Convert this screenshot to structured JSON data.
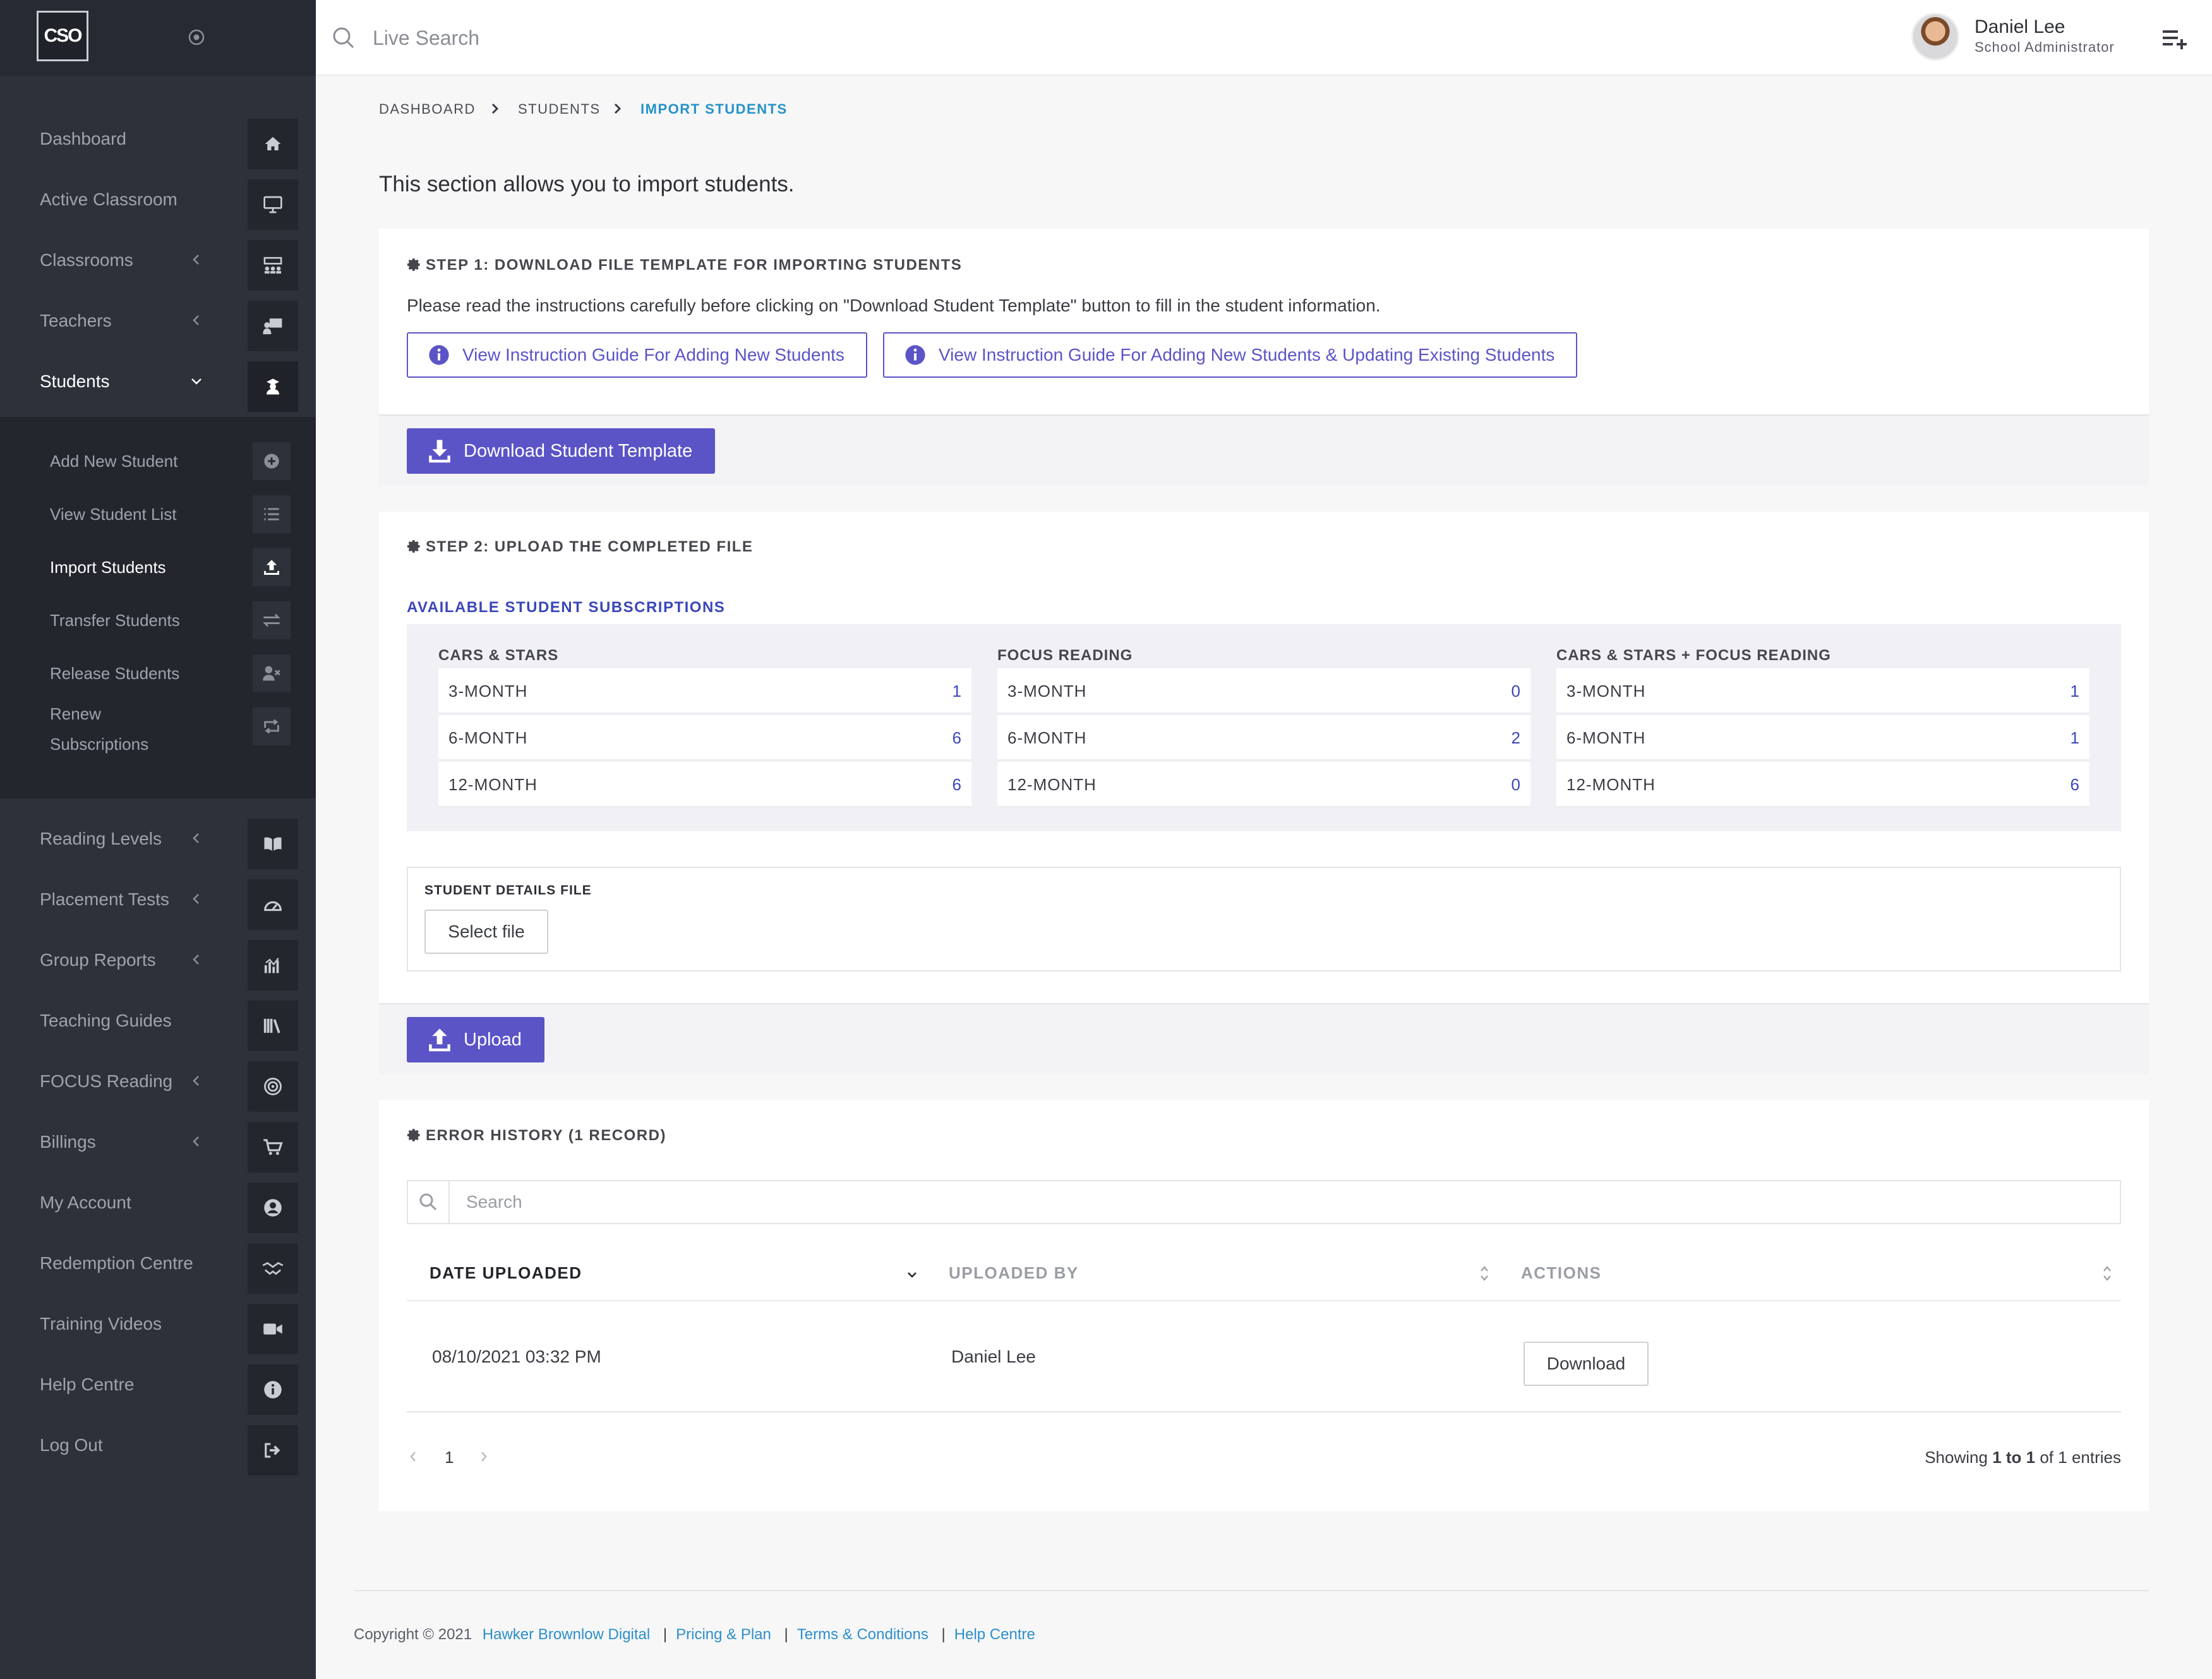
{
  "app": {
    "logo_text": "CSO",
    "search_placeholder": "Live Search"
  },
  "user": {
    "name": "Daniel Lee",
    "role": "School Administrator"
  },
  "sidebar": {
    "items": [
      {
        "label": "Dashboard",
        "icon": "home-icon"
      },
      {
        "label": "Active Classroom",
        "icon": "monitor-icon"
      },
      {
        "label": "Classrooms",
        "icon": "classroom-icon"
      },
      {
        "label": "Teachers",
        "icon": "teacher-icon"
      },
      {
        "label": "Students",
        "icon": "student-icon"
      },
      {
        "label": "Reading Levels",
        "icon": "book-icon"
      },
      {
        "label": "Placement Tests",
        "icon": "gauge-icon"
      },
      {
        "label": "Group Reports",
        "icon": "chart-icon"
      },
      {
        "label": "Teaching Guides",
        "icon": "library-icon"
      },
      {
        "label": "FOCUS Reading",
        "icon": "target-icon"
      },
      {
        "label": "Billings",
        "icon": "cart-icon"
      },
      {
        "label": "My Account",
        "icon": "user-circle-icon"
      },
      {
        "label": "Redemption Centre",
        "icon": "handshake-icon"
      },
      {
        "label": "Training Videos",
        "icon": "video-icon"
      },
      {
        "label": "Help Centre",
        "icon": "info-icon"
      },
      {
        "label": "Log Out",
        "icon": "logout-icon"
      }
    ],
    "students_sub": [
      {
        "label": "Add New Student",
        "icon": "plus-circle-icon"
      },
      {
        "label": "View Student List",
        "icon": "list-icon"
      },
      {
        "label": "Import Students",
        "icon": "upload-icon"
      },
      {
        "label": "Transfer Students",
        "icon": "transfer-icon"
      },
      {
        "label": "Release Students",
        "icon": "user-remove-icon"
      },
      {
        "label": "Renew Subscriptions",
        "icon": "renew-icon"
      }
    ]
  },
  "breadcrumb": [
    "DASHBOARD",
    "STUDENTS",
    "IMPORT STUDENTS"
  ],
  "intro": "This section allows you to import students.",
  "step1": {
    "title": "STEP 1: DOWNLOAD FILE TEMPLATE FOR IMPORTING STUDENTS",
    "instructions": "Please read the instructions carefully before clicking on \"Download Student Template\" button to fill in the student information.",
    "guide_new": "View Instruction Guide For Adding New Students",
    "guide_update": "View Instruction Guide For Adding New Students & Updating Existing Students",
    "download_button": "Download Student Template"
  },
  "step2": {
    "title": "STEP 2: UPLOAD THE COMPLETED FILE",
    "subs_title": "AVAILABLE STUDENT SUBSCRIPTIONS",
    "columns": [
      {
        "title": "CARS & STARS",
        "rows": [
          {
            "k": "3-MONTH",
            "v": "1"
          },
          {
            "k": "6-MONTH",
            "v": "6"
          },
          {
            "k": "12-MONTH",
            "v": "6"
          }
        ]
      },
      {
        "title": "FOCUS READING",
        "rows": [
          {
            "k": "3-MONTH",
            "v": "0"
          },
          {
            "k": "6-MONTH",
            "v": "2"
          },
          {
            "k": "12-MONTH",
            "v": "0"
          }
        ]
      },
      {
        "title": "CARS & STARS + FOCUS READING",
        "rows": [
          {
            "k": "3-MONTH",
            "v": "1"
          },
          {
            "k": "6-MONTH",
            "v": "1"
          },
          {
            "k": "12-MONTH",
            "v": "6"
          }
        ]
      }
    ],
    "file_label": "STUDENT DETAILS FILE",
    "select_file": "Select file",
    "upload_button": "Upload"
  },
  "errors": {
    "title": "ERROR HISTORY (1 RECORD)",
    "search_placeholder": "Search",
    "headers": [
      "DATE UPLOADED",
      "UPLOADED BY",
      "ACTIONS"
    ],
    "rows": [
      {
        "date": "08/10/2021 03:32 PM",
        "by": "Daniel Lee",
        "action": "Download"
      }
    ],
    "page": "1",
    "showing_prefix": "Showing ",
    "showing_from": "1",
    "showing_mid": " to ",
    "showing_to": "1",
    "showing_of": " of ",
    "showing_total": "1",
    "showing_suffix": " entries"
  },
  "footer": {
    "copyright": "Copyright © 2021",
    "company": "Hawker Brownlow Digital",
    "links": [
      "Pricing & Plan",
      "Terms & Conditions",
      "Help Centre"
    ]
  },
  "colors": {
    "sidebar": "#2d313a",
    "accent": "#5b54c7",
    "link": "#2c8fc9"
  }
}
